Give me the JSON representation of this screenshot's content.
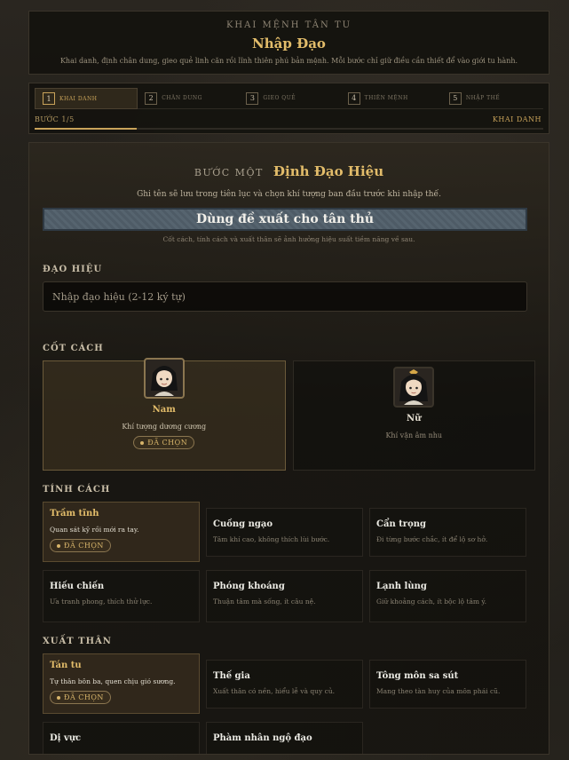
{
  "header": {
    "kicker": "KHAI MỆNH TÂN TU",
    "title": "Nhập Đạo",
    "description": "Khai danh, định chân dung, gieo quẻ linh căn rồi lĩnh thiên phú bản mệnh. Mỗi bước chỉ giữ điều cần thiết để vào giới tu hành."
  },
  "steps": {
    "items": [
      {
        "num": "1",
        "label": "KHAI DANH",
        "active": true
      },
      {
        "num": "2",
        "label": "CHÂN DUNG"
      },
      {
        "num": "3",
        "label": "GIEO QUẺ"
      },
      {
        "num": "4",
        "label": "THIÊN MỆNH"
      },
      {
        "num": "5",
        "label": "NHẬP THẾ"
      }
    ],
    "counter": "BƯỚC 1/5",
    "current": "KHAI DANH",
    "progress": 0.2
  },
  "section": {
    "prefix": "BƯỚC MỘT",
    "title": "Định Đạo Hiệu",
    "subtitle": "Ghi tên sẽ lưu trong tiên lục và chọn khí tượng ban đầu trước khi nhập thế.",
    "suggest_button": "Dùng đề xuất cho tân thủ",
    "suggest_note": "Cốt cách, tính cách và xuất thân sẽ ảnh hưởng hiệu suất tiềm năng về sau."
  },
  "name_field": {
    "label": "ĐẠO HIỆU",
    "placeholder": "Nhập đạo hiệu (2-12 ký tự)"
  },
  "gender": {
    "label": "CỐT CÁCH",
    "options": [
      {
        "name": "Nam",
        "desc": "Khí tượng dương cương",
        "badge": "ĐÃ CHỌN"
      },
      {
        "name": "Nữ",
        "desc": "Khí vận âm nhu"
      }
    ]
  },
  "personality": {
    "label": "TÍNH CÁCH",
    "options": [
      {
        "name": "Trầm tĩnh",
        "desc": "Quan sát kỹ rồi mới ra tay.",
        "badge": "ĐÃ CHỌN"
      },
      {
        "name": "Cuồng ngạo",
        "desc": "Tâm khí cao, không thích lùi bước."
      },
      {
        "name": "Cẩn trọng",
        "desc": "Đi từng bước chắc, ít để lộ sơ hở."
      },
      {
        "name": "Hiếu chiến",
        "desc": "Ưa tranh phong, thích thử lực."
      },
      {
        "name": "Phóng khoáng",
        "desc": "Thuận tâm mà sống, ít câu nệ."
      },
      {
        "name": "Lạnh lùng",
        "desc": "Giữ khoảng cách, ít bộc lộ tâm ý."
      }
    ]
  },
  "origin": {
    "label": "XUẤT THÂN",
    "options": [
      {
        "name": "Tán tu",
        "desc": "Tự thân bôn ba, quen chịu gió sương.",
        "badge": "ĐÃ CHỌN"
      },
      {
        "name": "Thế gia",
        "desc": "Xuất thân có nền, hiểu lễ và quy củ."
      },
      {
        "name": "Tông môn sa sút",
        "desc": "Mang theo tàn huy của môn phái cũ."
      },
      {
        "name": "Dị vực",
        "desc": ""
      },
      {
        "name": "Phàm nhân ngộ đạo",
        "desc": ""
      }
    ]
  },
  "colors": {
    "accent": "#e2bc6a",
    "button": "#4e5b66"
  }
}
